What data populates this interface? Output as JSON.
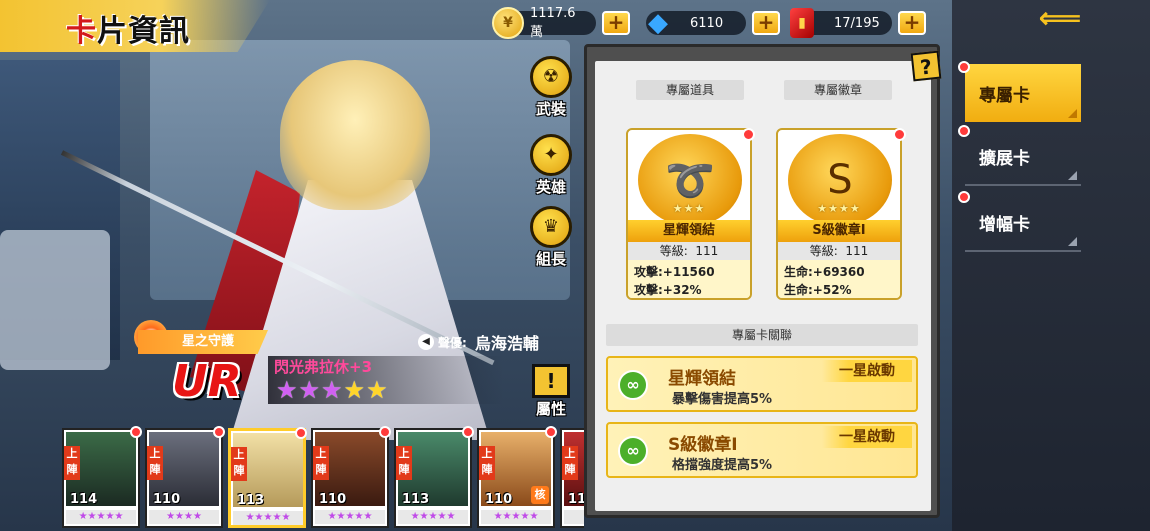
{
  "header": {
    "title_accent": "卡",
    "title_rest": "片資訊"
  },
  "currencies": [
    {
      "name": "coin",
      "icon": "coin-icon",
      "value": "1117.6萬"
    },
    {
      "name": "gem",
      "icon": "diamond-icon",
      "value": "6110"
    },
    {
      "name": "card",
      "icon": "card-pack-icon",
      "value": "17/195"
    }
  ],
  "side_nav": {
    "items": [
      {
        "label": "專屬卡",
        "active": true
      },
      {
        "label": "擴展卡",
        "active": false
      },
      {
        "label": "增幅卡",
        "active": false
      }
    ]
  },
  "info_panel": {
    "help_label": "?",
    "section_items": "專屬道具",
    "section_badges": "專屬徽章",
    "section_link": "專屬卡關聯",
    "item_cards": [
      {
        "name": "星輝領結",
        "stars": "★★★",
        "level_label": "等級:",
        "level": "111",
        "stats": [
          "攻擊:+11560",
          "攻擊:+32%"
        ]
      },
      {
        "name": "S級徽章I",
        "stars": "★★★★",
        "level_label": "等級:",
        "level": "111",
        "stats": [
          "生命:+69360",
          "生命:+52%"
        ]
      }
    ],
    "link_rows": [
      {
        "title": "星輝領結",
        "desc": "暴擊傷害提高5%",
        "badge": "一星啟動"
      },
      {
        "title": "S級徽章I",
        "desc": "格擋強度提高5%",
        "badge": "一星啟動"
      }
    ]
  },
  "skills": [
    {
      "label": "武裝",
      "icon": "armament-icon"
    },
    {
      "label": "英雄",
      "icon": "eagle-emblem-icon"
    },
    {
      "label": "組長",
      "icon": "crown-icon"
    }
  ],
  "hero": {
    "guard_label": "星之守護",
    "rarity": "UR",
    "name": "閃光弗拉休+3",
    "stars_pink": "★★★",
    "stars_gold": "★★",
    "voice_label": "聲優:",
    "voice_name": "烏海浩輔",
    "attribute_label": "屬性"
  },
  "roster": {
    "deploy_label": "上陣",
    "portraits": [
      {
        "level": "114",
        "stars": "★★★★★",
        "deployed": true,
        "selected": false
      },
      {
        "level": "110",
        "stars": "★★★★",
        "deployed": true,
        "selected": false
      },
      {
        "level": "113",
        "stars": "★★★★★",
        "deployed": true,
        "selected": true
      },
      {
        "level": "110",
        "stars": "★★★★★",
        "deployed": true,
        "selected": false
      },
      {
        "level": "113",
        "stars": "★★★★★",
        "deployed": true,
        "selected": false
      },
      {
        "level": "110",
        "stars": "★★★★★",
        "deployed": true,
        "selected": false,
        "badge": "核"
      },
      {
        "level": "11",
        "stars": "★",
        "deployed": true,
        "selected": false
      }
    ]
  },
  "colors": {
    "accent_gold": "#f3c331",
    "alert_red": "#ff3b3b",
    "rarity_red": "#e81515",
    "nav_bg": "#2e3542"
  }
}
